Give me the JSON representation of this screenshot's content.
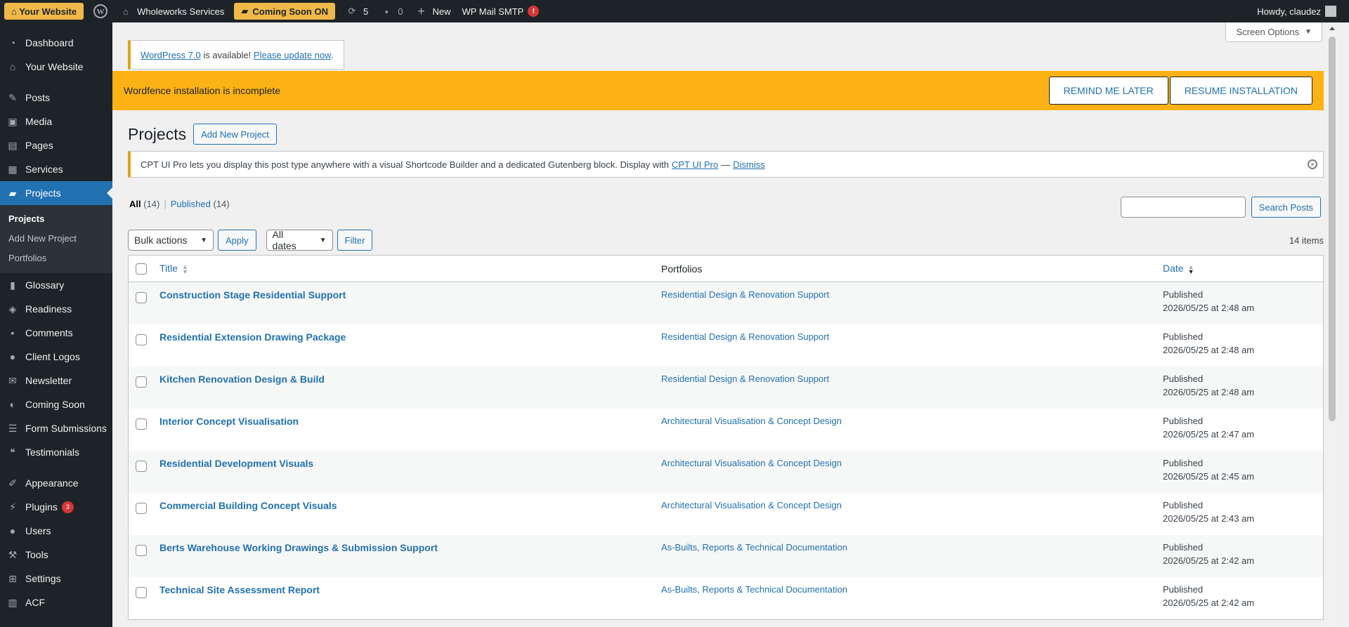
{
  "adminbar": {
    "site_badge": "⌂ Your Website",
    "site_name": "Wholeworks Services",
    "coming_soon": "Coming Soon ON",
    "updates_count": "5",
    "comments_count": "0",
    "new_label": "New",
    "smtp_label": "WP Mail SMTP",
    "smtp_badge": "!",
    "howdy": "Howdy, claudez"
  },
  "sidebar": {
    "items": [
      {
        "label": "Dashboard"
      },
      {
        "label": "Your Website"
      },
      {
        "label": "Posts"
      },
      {
        "label": "Media"
      },
      {
        "label": "Pages"
      },
      {
        "label": "Services"
      },
      {
        "label": "Projects"
      },
      {
        "label": "Glossary"
      },
      {
        "label": "Readiness"
      },
      {
        "label": "Comments"
      },
      {
        "label": "Client Logos"
      },
      {
        "label": "Newsletter"
      },
      {
        "label": "Coming Soon"
      },
      {
        "label": "Form Submissions"
      },
      {
        "label": "Testimonials"
      },
      {
        "label": "Appearance"
      },
      {
        "label": "Plugins",
        "badge": "3"
      },
      {
        "label": "Users"
      },
      {
        "label": "Tools"
      },
      {
        "label": "Settings"
      },
      {
        "label": "ACF"
      }
    ],
    "submenu": [
      "Projects",
      "Add New Project",
      "Portfolios"
    ]
  },
  "screen_options": "Screen Options",
  "update_nag": {
    "link": "WordPress 7.0",
    "mid": " is available! ",
    "update_link": "Please update now",
    "end": "."
  },
  "wordfence": {
    "text": "Wordfence installation is incomplete",
    "remind": "REMIND ME LATER",
    "resume": "RESUME INSTALLATION"
  },
  "page": {
    "title": "Projects",
    "add_new": "Add New Project"
  },
  "cpt_notice": {
    "text": "CPT UI Pro lets you display this post type anywhere with a visual Shortcode Builder and a dedicated Gutenberg block. Display with",
    "link": "CPT UI Pro",
    "dash": "—",
    "dismiss": "Dismiss"
  },
  "views": {
    "all": "All",
    "all_count": "(14)",
    "published": "Published",
    "published_count": "(14)"
  },
  "search": {
    "button": "Search Posts"
  },
  "tablenav": {
    "bulk": "Bulk actions",
    "apply": "Apply",
    "dates": "All dates",
    "filter": "Filter",
    "items": "14 items"
  },
  "table": {
    "headers": {
      "title": "Title",
      "portfolios": "Portfolios",
      "date": "Date"
    },
    "rows": [
      {
        "title": "Construction Stage Residential Support",
        "portfolio": "Residential Design & Renovation Support",
        "status": "Published",
        "date": "2026/05/25 at 2:48 am"
      },
      {
        "title": "Residential Extension Drawing Package",
        "portfolio": "Residential Design & Renovation Support",
        "status": "Published",
        "date": "2026/05/25 at 2:48 am"
      },
      {
        "title": "Kitchen Renovation Design & Build",
        "portfolio": "Residential Design & Renovation Support",
        "status": "Published",
        "date": "2026/05/25 at 2:48 am"
      },
      {
        "title": "Interior Concept Visualisation",
        "portfolio": "Architectural Visualisation & Concept Design",
        "status": "Published",
        "date": "2026/05/25 at 2:47 am"
      },
      {
        "title": "Residential Development Visuals",
        "portfolio": "Architectural Visualisation & Concept Design",
        "status": "Published",
        "date": "2026/05/25 at 2:45 am"
      },
      {
        "title": "Commercial Building Concept Visuals",
        "portfolio": "Architectural Visualisation & Concept Design",
        "status": "Published",
        "date": "2026/05/25 at 2:43 am"
      },
      {
        "title": "Berts Warehouse Working Drawings & Submission Support",
        "portfolio": "As-Builts, Reports & Technical Documentation",
        "status": "Published",
        "date": "2026/05/25 at 2:42 am"
      },
      {
        "title": "Technical Site Assessment Report",
        "portfolio": "As-Builts, Reports & Technical Documentation",
        "status": "Published",
        "date": "2026/05/25 at 2:42 am"
      }
    ]
  }
}
